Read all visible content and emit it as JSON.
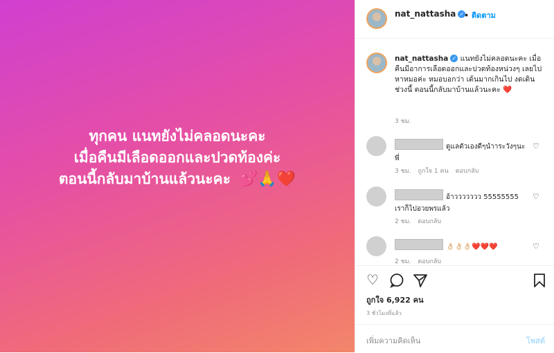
{
  "post": {
    "image_lines": [
      "ทุกคน  แนทยังไม่คลอดนะคะ",
      "เมื่อคืนมีเลือดออกและปวดท้องค่ะ",
      "ตอนนี้กลับมาบ้านแล้วนะคะ"
    ],
    "image_emoji": "💕🙏❤️"
  },
  "header": {
    "username": "nat_nattasha",
    "follow_label": "ติดตาม"
  },
  "caption": {
    "username": "nat_nattasha",
    "text": "แนทยังไม่คลอดนะคะ เมื่อคืนมีอาการเลือดออกและปวดท้องหน่วงๆ เลยไปหาหมอค่ะ หมอบอกว่า เด้นมากเกินไป งดเดินช่วงนี้ ตอนนี้กลับมาบ้านแล้วนะคะ",
    "emoji": "❤️",
    "time": "3 ชม."
  },
  "comments": [
    {
      "text": "ดูแลตัวเองดีๆนำาระวังๆนะพี่",
      "time": "3 ชม.",
      "likes": "ถูกใจ 1 คน",
      "reply": "ตอบกลับ"
    },
    {
      "text": "อ้าววววววว 55555555 เราก็ไปอวยพรแล้ว",
      "time": "2 ชม.",
      "reply": "ตอบกลับ"
    },
    {
      "text": "👌🏻👌🏻👌🏻❤️❤️❤️",
      "time": "2 ชม.",
      "reply": "ตอบกลับ"
    }
  ],
  "actions": {
    "likes_text": "ถูกใจ 6,922 คน",
    "time_ago": "3 ชั่วโมงที่แล้ว",
    "comment_placeholder": "เพิ่มความคิดเห็น",
    "post_label": "โพสต์"
  }
}
